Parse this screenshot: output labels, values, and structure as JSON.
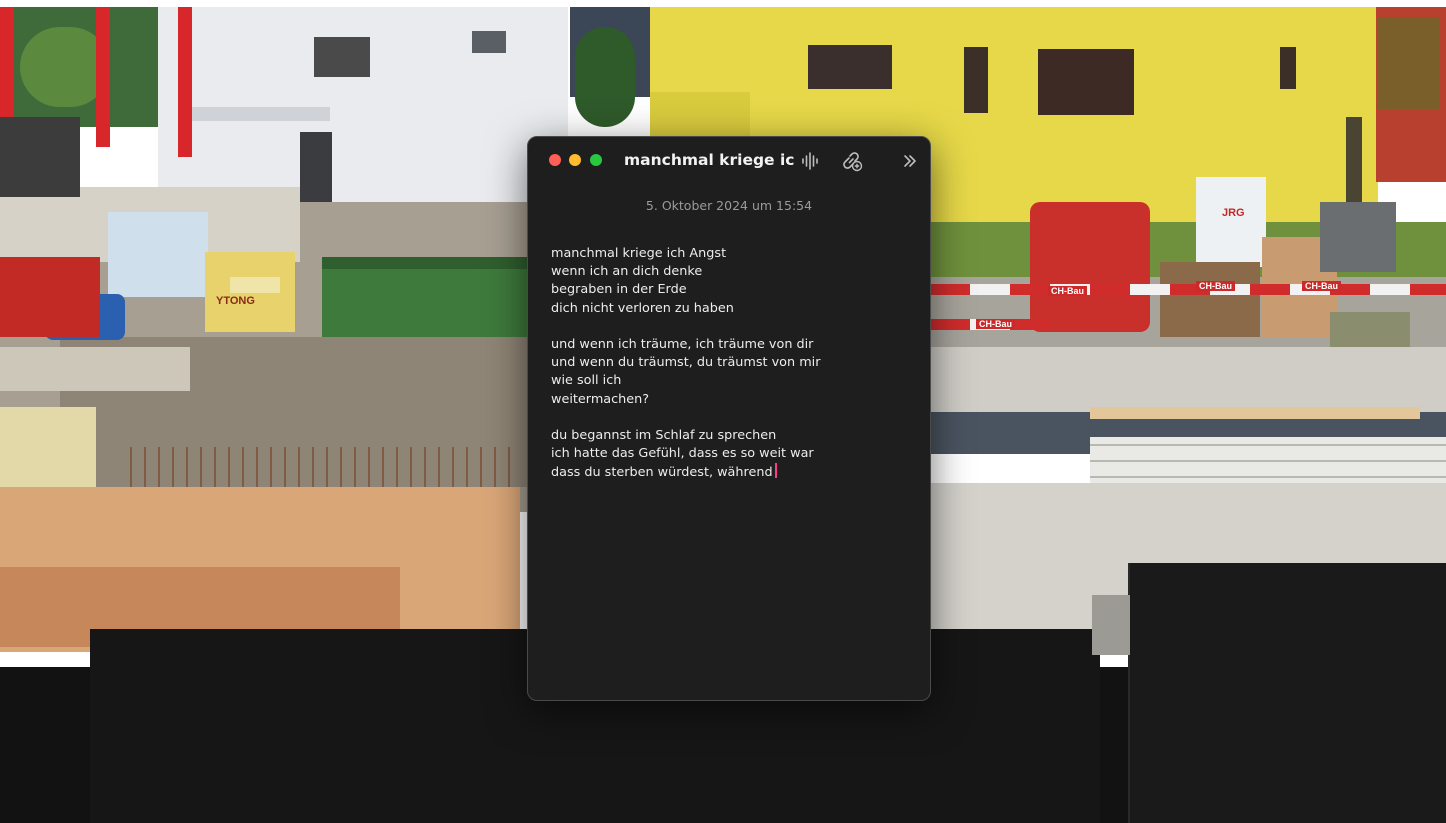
{
  "desktop": {
    "wallpaper_signs": {
      "jrg": "JRG",
      "ch_bau_1": "CH-Bau",
      "ch_bau_2": "CH-Bau",
      "ch_bau_3": "CH-Bau",
      "ch_bau_4": "CH-Bau",
      "ytong": "YTONG"
    }
  },
  "note_window": {
    "title": "manchmal kriege ic...",
    "date": "5. Oktober 2024 um 15:54",
    "lines": [
      "manchmal kriege ich Angst",
      "wenn ich an dich denke",
      "begraben in der Erde",
      "dich nicht verloren zu haben",
      "",
      "und wenn ich träume, ich träume von dir",
      "und wenn du träumst, du träumst von mir",
      "wie soll ich",
      "weitermachen?",
      "",
      "du begannst im Schlaf zu sprechen",
      "ich hatte das Gefühl, dass es so weit war",
      "dass du sterben würdest, während"
    ],
    "colors": {
      "window_bg": "#1e1e1e",
      "text": "#ededed",
      "date": "#9a9a9a",
      "cursor": "#ff3b8d",
      "close": "#fe5f57",
      "minimize": "#febc2e",
      "zoom": "#28c840"
    },
    "toolbar_icons": [
      "waveform-icon",
      "link-add-icon",
      "chevron-double-right-icon"
    ]
  }
}
